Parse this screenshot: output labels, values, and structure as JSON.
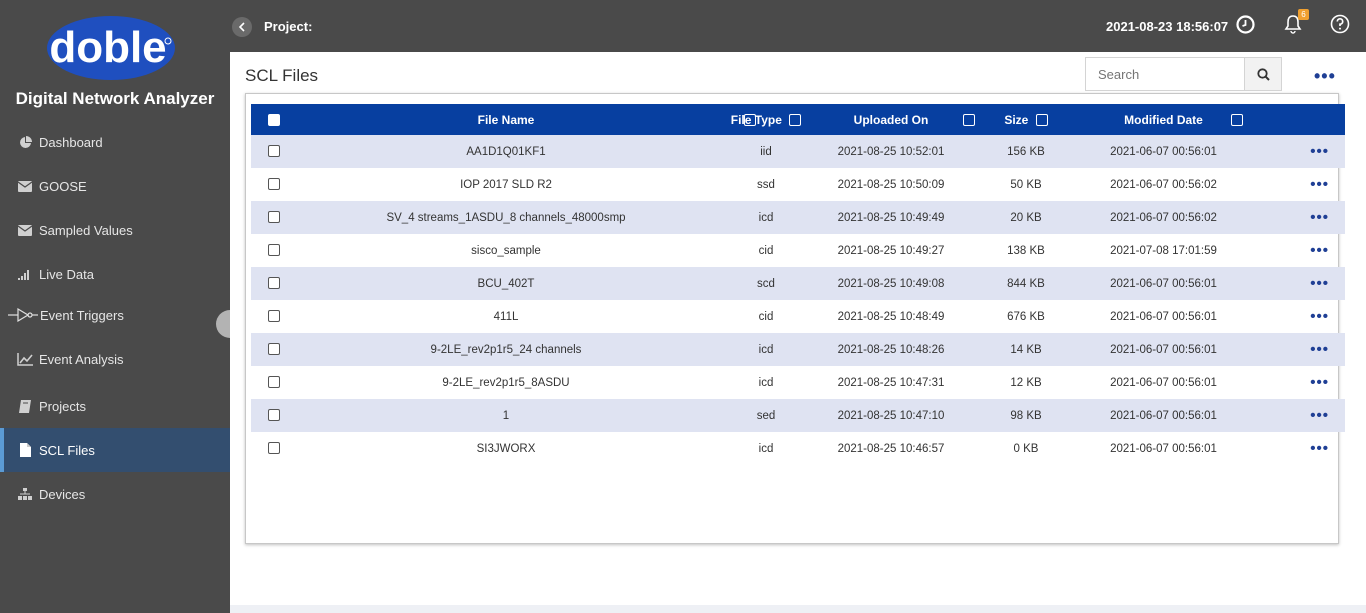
{
  "app": {
    "logo_text": "doble",
    "title": "Digital Network Analyzer"
  },
  "sidebar": {
    "items": [
      {
        "label": "Dashboard",
        "icon": "pie-chart-icon"
      },
      {
        "label": "GOOSE",
        "icon": "envelope-icon"
      },
      {
        "label": "Sampled Values",
        "icon": "envelope-icon"
      },
      {
        "label": "Live Data",
        "icon": "signal-bars-icon"
      },
      {
        "label": "Event Triggers",
        "icon": "trigger-icon"
      },
      {
        "label": "Event Analysis",
        "icon": "line-chart-icon"
      },
      {
        "label": "Projects",
        "icon": "book-icon"
      },
      {
        "label": "SCL Files",
        "icon": "file-icon",
        "active": true
      },
      {
        "label": "Devices",
        "icon": "sitemap-icon"
      }
    ]
  },
  "topbar": {
    "project_label": "Project:",
    "datetime": "2021-08-23 18:56:07",
    "notification_count": "6"
  },
  "page": {
    "title": "SCL Files",
    "search_placeholder": "Search"
  },
  "table": {
    "headers": [
      "File Name",
      "File Type",
      "Uploaded On",
      "Size",
      "Modified Date"
    ],
    "rows": [
      {
        "name": "AA1D1Q01KF1",
        "type": "iid",
        "uploaded": "2021-08-25 10:52:01",
        "size": "156 KB",
        "modified": "2021-06-07 00:56:01"
      },
      {
        "name": "IOP 2017 SLD R2",
        "type": "ssd",
        "uploaded": "2021-08-25 10:50:09",
        "size": "50 KB",
        "modified": "2021-06-07 00:56:02"
      },
      {
        "name": "SV_4 streams_1ASDU_8 channels_48000smp",
        "type": "icd",
        "uploaded": "2021-08-25 10:49:49",
        "size": "20 KB",
        "modified": "2021-06-07 00:56:02"
      },
      {
        "name": "sisco_sample",
        "type": "cid",
        "uploaded": "2021-08-25 10:49:27",
        "size": "138 KB",
        "modified": "2021-07-08 17:01:59"
      },
      {
        "name": "BCU_402T",
        "type": "scd",
        "uploaded": "2021-08-25 10:49:08",
        "size": "844 KB",
        "modified": "2021-06-07 00:56:01"
      },
      {
        "name": "411L",
        "type": "cid",
        "uploaded": "2021-08-25 10:48:49",
        "size": "676 KB",
        "modified": "2021-06-07 00:56:01"
      },
      {
        "name": "9-2LE_rev2p1r5_24 channels",
        "type": "icd",
        "uploaded": "2021-08-25 10:48:26",
        "size": "14 KB",
        "modified": "2021-06-07 00:56:01"
      },
      {
        "name": "9-2LE_rev2p1r5_8ASDU",
        "type": "icd",
        "uploaded": "2021-08-25 10:47:31",
        "size": "12 KB",
        "modified": "2021-06-07 00:56:01"
      },
      {
        "name": "1",
        "type": "sed",
        "uploaded": "2021-08-25 10:47:10",
        "size": "98 KB",
        "modified": "2021-06-07 00:56:01"
      },
      {
        "name": "SI3JWORX",
        "type": "icd",
        "uploaded": "2021-08-25 10:46:57",
        "size": "0 KB",
        "modified": "2021-06-07 00:56:01"
      }
    ]
  },
  "colors": {
    "sidebar_bg": "#4a4a4a",
    "header_blue": "#073fa0",
    "row_stripe": "#dfe3f2",
    "active_item": "#334e6f",
    "accent_dots": "#1f3f95"
  }
}
